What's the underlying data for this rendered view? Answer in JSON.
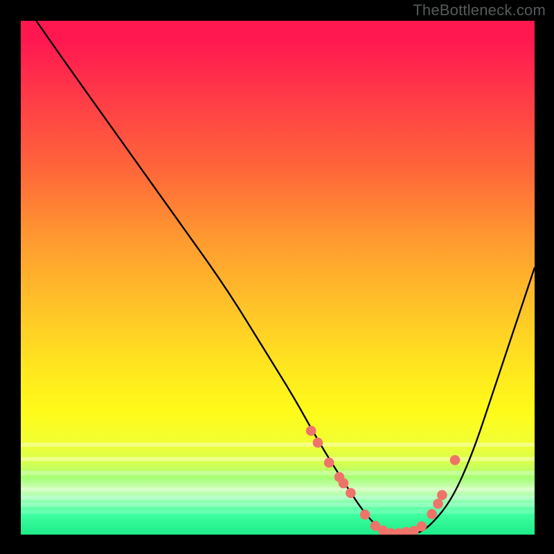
{
  "watermark": "TheBottleneck.com",
  "chart_data": {
    "type": "line",
    "title": "",
    "xlabel": "",
    "ylabel": "",
    "xlim": [
      0,
      100
    ],
    "ylim": [
      0,
      100
    ],
    "curve": {
      "name": "bottleneck-curve",
      "x": [
        3,
        10,
        20,
        30,
        40,
        48,
        53,
        58,
        63,
        67,
        70,
        73,
        77,
        80,
        84,
        88,
        92,
        96,
        100
      ],
      "y": [
        100,
        90,
        76,
        62,
        48,
        35,
        27,
        18,
        10,
        4,
        1,
        0,
        0,
        2,
        7,
        16,
        28,
        40,
        52
      ]
    },
    "markers": {
      "name": "highlight-points",
      "color": "#ee746a",
      "x": [
        56.5,
        57.8,
        60.0,
        62.0,
        62.8,
        64.2,
        67.0,
        69.0,
        70.5,
        72.0,
        73.5,
        75.0,
        76.5,
        78.0,
        80.0,
        81.2,
        82.0,
        84.5
      ],
      "y": [
        20.2,
        17.9,
        14.0,
        11.2,
        10.0,
        8.1,
        3.9,
        1.7,
        0.8,
        0.3,
        0.3,
        0.5,
        0.7,
        1.6,
        4.0,
        6.0,
        7.7,
        14.5
      ]
    },
    "bands": [
      {
        "y": 82.5,
        "color": "rgba(255,255,255,0.38)"
      },
      {
        "y": 85.3,
        "color": "rgba(251,255,192,0.55)"
      },
      {
        "y": 88.0,
        "color": "rgba(215,255,200,0.50)"
      },
      {
        "y": 91.2,
        "color": "rgba(255,255,255,0.25)"
      },
      {
        "y": 92.8,
        "color": "rgba(200,255,230,0.45)"
      },
      {
        "y": 94.2,
        "color": "rgba(255,255,255,0.20)"
      },
      {
        "y": 95.6,
        "color": "rgba(140,255,200,0.40)"
      }
    ]
  }
}
